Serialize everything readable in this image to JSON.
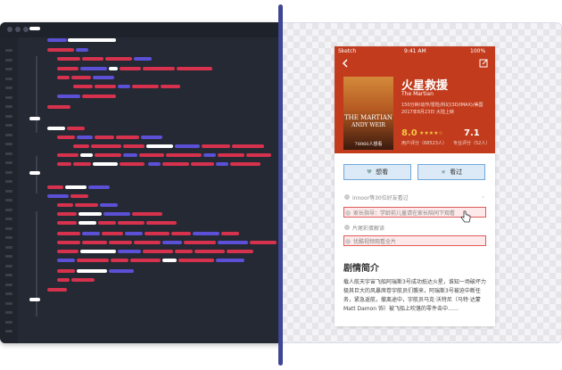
{
  "status_bar": {
    "carrier": "Sketch",
    "time": "9:41 AM",
    "battery": "100%"
  },
  "movie": {
    "title_cn": "火星救援",
    "title_en": "The Martian",
    "info_line1": "150分钟/动作/冒险/科幻(3D/IMAX)/美国",
    "info_line2": "2017年8月23日 大陆上映",
    "poster_title": "THE MARTIAN",
    "poster_author": "ANDY WEIR",
    "poster_caption": "78960人想看",
    "score": "8.0",
    "stars": "★★★★☆",
    "score_label": "用户评分（68523人）",
    "pro_score": "7.1",
    "pro_score_label": "专业评分（52人）"
  },
  "buttons": {
    "want": "想看",
    "seen": "看过"
  },
  "rows": [
    {
      "text": "innoor等30位好友看过",
      "highlight": false
    },
    {
      "text": "家长指导：学龄前儿童请在家长陪同下观看",
      "highlight": true
    },
    {
      "text": "片尾彩蛋解读",
      "highlight": false
    },
    {
      "text": "优酷视频观看全片",
      "highlight": true
    }
  ],
  "synopsis": {
    "heading": "剧情简介",
    "text": "载人航天宇宙飞船阿瑞斯3号成功抵达火星，谁知一场破坏力极其巨大的风暴席卷宇航员们襲来，阿瑞斯3号被迫中断任务，紧急返航，撤离途中，宇航员马克·沃特尼（马特·达蒙 Matt Damon 饰）被飞船上吹落的零件击中……"
  },
  "colors": {
    "accent": "#c23b1c",
    "highlight_border": "#e05a5a",
    "button_blue": "#6fa8dc",
    "divider": "#3f4694"
  }
}
